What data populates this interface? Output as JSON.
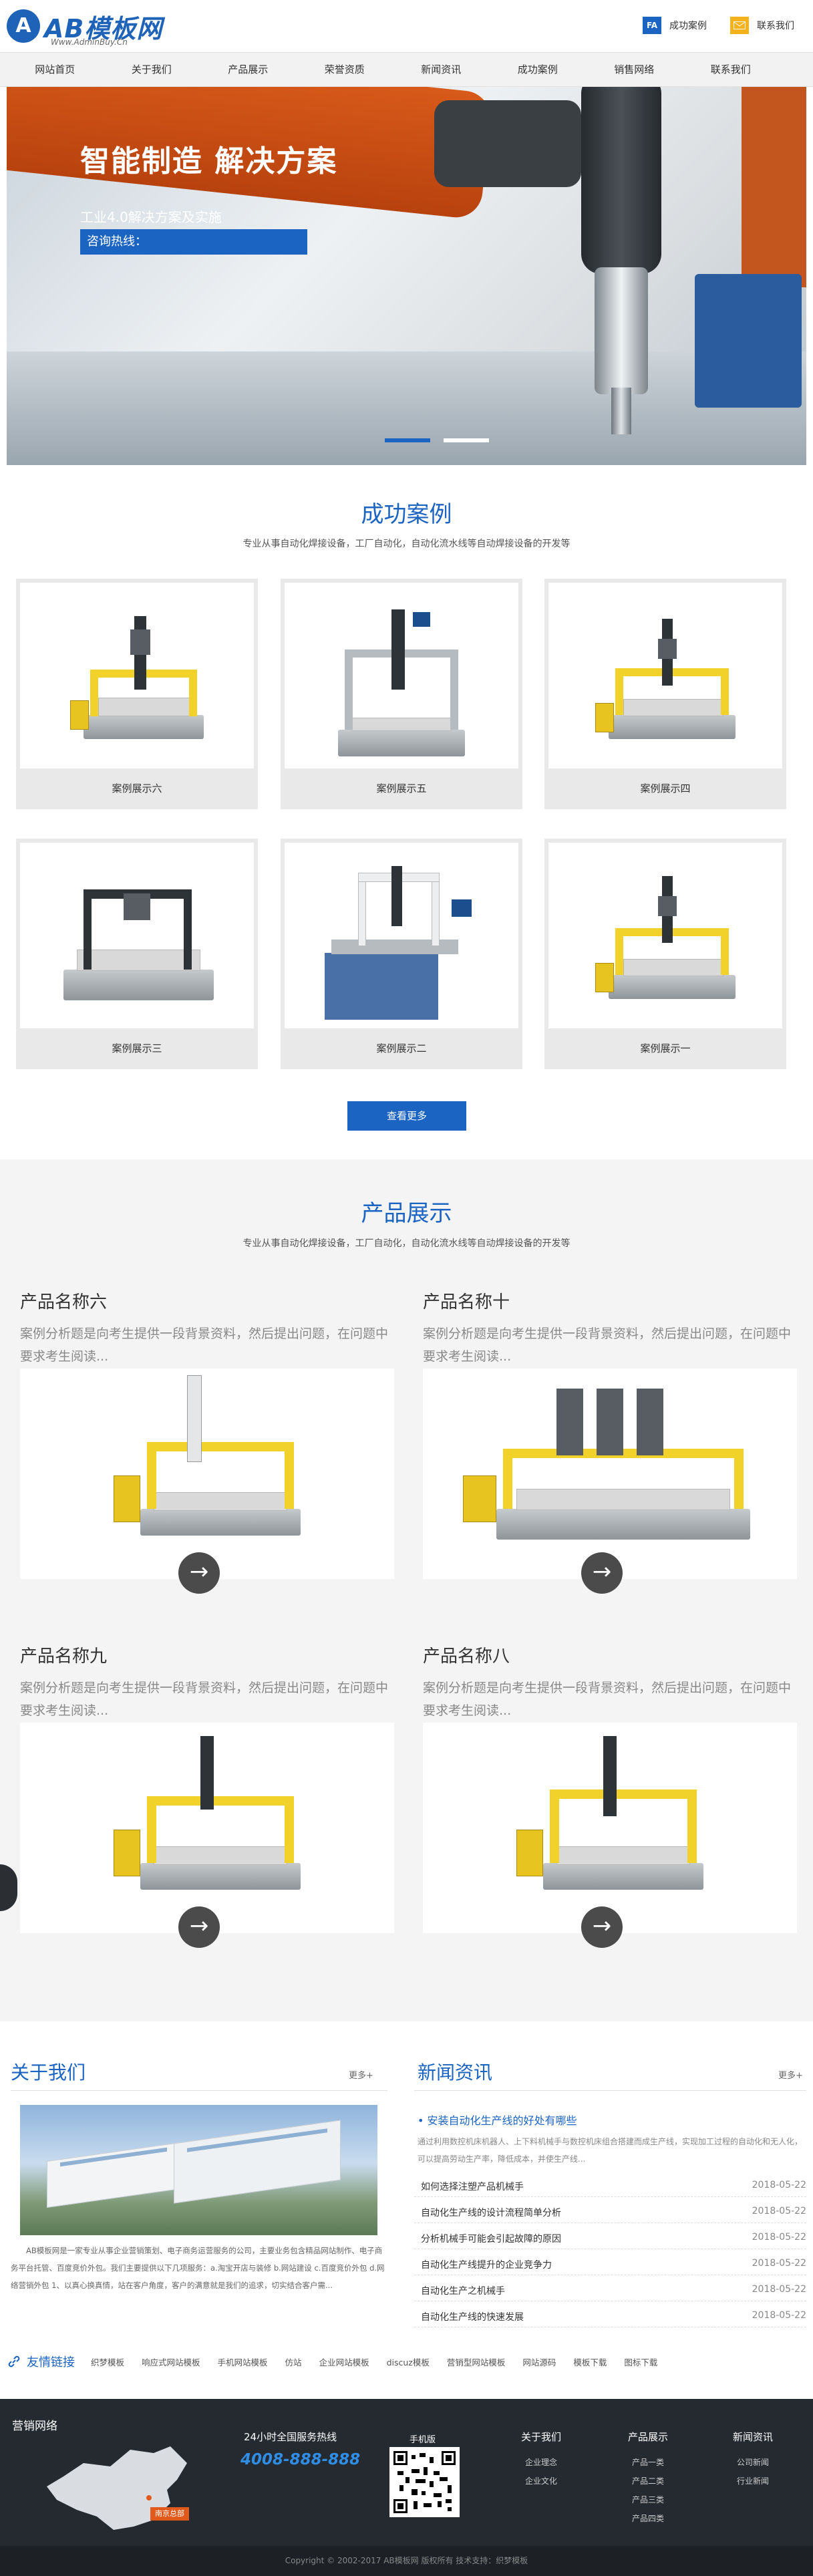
{
  "header": {
    "logo_mark": "A",
    "logo_name": "AB模板网",
    "logo_url_text": "Www.AdminBuy.Cn",
    "link_cases": "成功案例",
    "link_contact": "联系我们",
    "link_cases_icon": "FA"
  },
  "nav": [
    "网站首页",
    "关于我们",
    "产品展示",
    "荣誉资质",
    "新闻资讯",
    "成功案例",
    "销售网络",
    "联系我们"
  ],
  "banner": {
    "title": "智能制造 解决方案",
    "subtitle": "工业4.0解决方案及实施",
    "hotline": "咨询热线："
  },
  "cases": {
    "title": "成功案例",
    "desc": "专业从事自动化焊接设备，工厂自动化，自动化流水线等自动焊接设备的开发等",
    "items": [
      "案例展示六",
      "案例展示五",
      "案例展示四",
      "案例展示三",
      "案例展示二",
      "案例展示一"
    ],
    "more": "查看更多"
  },
  "products": {
    "title": "产品展示",
    "desc": "专业从事自动化焊接设备，工厂自动化，自动化流水线等自动焊接设备的开发等",
    "items": [
      {
        "name": "产品名称六",
        "desc": "案例分析题是向考生提供一段背景资料，然后提出问题，在问题中要求考生阅读..."
      },
      {
        "name": "产品名称十",
        "desc": "案例分析题是向考生提供一段背景资料，然后提出问题，在问题中要求考生阅读..."
      },
      {
        "name": "产品名称九",
        "desc": "案例分析题是向考生提供一段背景资料，然后提出问题，在问题中要求考生阅读..."
      },
      {
        "name": "产品名称八",
        "desc": "案例分析题是向考生提供一段背景资料，然后提出问题，在问题中要求考生阅读..."
      }
    ],
    "arrow_icon": "→"
  },
  "about": {
    "title": "关于我们",
    "more": "更多+",
    "text": "AB模板网是一家专业从事企业营销策划、电子商务运营服务的公司，主要业务包含精品网站制作、电子商务平台托管、百度竞价外包。我们主要提供以下几项服务：a.淘宝开店与装修 b.网站建设 c.百度竞价外包 d.网络营销外包 1、以真心换真情，站在客户角度，客户的满意就是我们的追求，切实结合客户需..."
  },
  "news": {
    "title": "新闻资讯",
    "more": "更多+",
    "featured_title": "安装自动化生产线的好处有哪些",
    "featured_text": "通过利用数控机床机器人、上下料机械手与数控机床组合搭建而成生产线，实现加工过程的自动化和无人化，可以提高劳动生产率，降低成本，并使生产线...",
    "items": [
      {
        "title": "如何选择注塑产品机械手",
        "date": "2018-05-22"
      },
      {
        "title": "自动化生产线的设计流程简单分析",
        "date": "2018-05-22"
      },
      {
        "title": "分析机械手可能会引起故障的原因",
        "date": "2018-05-22"
      },
      {
        "title": "自动化生产线提升的企业竞争力",
        "date": "2018-05-22"
      },
      {
        "title": "自动化生产之机械手",
        "date": "2018-05-22"
      },
      {
        "title": "自动化生产线的快速发展",
        "date": "2018-05-22"
      }
    ]
  },
  "links": {
    "title": "友情链接",
    "items": [
      "织梦模板",
      "响应式网站模板",
      "手机网站模板",
      "仿站",
      "企业网站模板",
      "discuz模板",
      "营销型网站模板",
      "网站源码",
      "模板下载",
      "图标下载"
    ]
  },
  "footer": {
    "network_title": "营销网络",
    "map_label": "南京总部",
    "hotline_label": "24小时全国服务热线",
    "hotline": "4008-888-888",
    "mobile_label": "手机版",
    "cols": [
      {
        "title": "关于我们",
        "items": [
          "企业理念",
          "企业文化"
        ]
      },
      {
        "title": "产品展示",
        "items": [
          "产品一类",
          "产品二类",
          "产品三类",
          "产品四类"
        ]
      },
      {
        "title": "新闻资讯",
        "items": [
          "公司新闻",
          "行业新闻"
        ]
      }
    ],
    "copyright": "Copyright © 2002-2017 AB模板网 版权所有 技术支持：织梦模板"
  }
}
